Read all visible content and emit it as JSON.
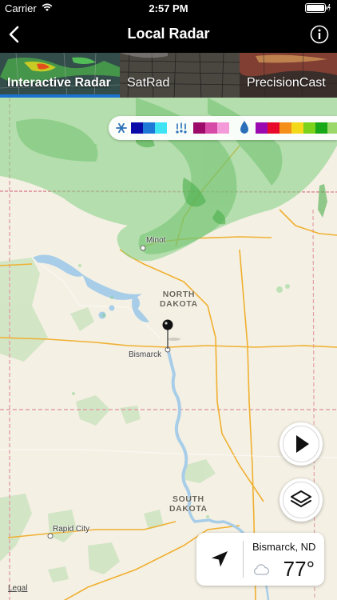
{
  "status_bar": {
    "carrier": "Carrier",
    "time": "2:57 PM"
  },
  "header": {
    "title": "Local Radar",
    "back_icon": "chevron-left-icon",
    "info_icon": "info-icon"
  },
  "tabs": [
    {
      "label": "Interactive Radar",
      "active": true
    },
    {
      "label": "SatRad",
      "active": false
    },
    {
      "label": "PrecisionCast",
      "active": false
    }
  ],
  "legend": {
    "snow_colors": [
      "#0a0aa8",
      "#1e78d8",
      "#3ee4f4"
    ],
    "mix_colors": [
      "#9c0a6a",
      "#d84aa8",
      "#f49ad8"
    ],
    "rain_colors": [
      "#9a0ab0",
      "#e80a2a",
      "#f4901a",
      "#f4d81a",
      "#7ad21a",
      "#18a818"
    ],
    "icons": [
      "snowflake-icon",
      "mix-icon",
      "raindrop-icon"
    ]
  },
  "map": {
    "cities": [
      "Minot",
      "Bismarck",
      "Rapid City"
    ],
    "states": [
      {
        "line1": "NORTH",
        "line2": "DAKOTA"
      },
      {
        "line1": "SOUTH",
        "line2": "DAKOTA"
      }
    ],
    "pin_icon": "map-pin-icon",
    "legal": "Legal"
  },
  "controls": {
    "play_icon": "play-icon",
    "layers_icon": "layers-icon"
  },
  "weather_card": {
    "location": "Bismarck, ND",
    "temperature": "77°",
    "condition_icon": "cloud-icon",
    "location_icon": "location-arrow-icon"
  }
}
